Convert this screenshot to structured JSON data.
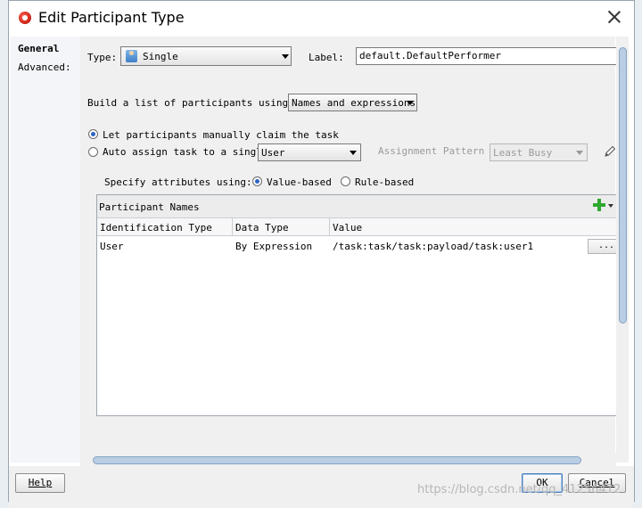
{
  "dialog": {
    "title": "Edit Participant Type"
  },
  "nav": {
    "items": [
      {
        "label": "General",
        "active": true
      },
      {
        "label": "Advanced:",
        "active": false
      }
    ]
  },
  "form": {
    "type_label": "Type:",
    "type_value": "Single",
    "label_label": "Label:",
    "label_value": "default.DefaultPerformer",
    "build_list_label": "Build a list of participants using:",
    "build_list_value": "Names and expressions",
    "radio_manual": "Let participants manually claim the task",
    "radio_auto": "Auto assign task to a single",
    "auto_target": "User",
    "assignment_pattern_label": "Assignment Pattern :",
    "assignment_pattern_value": "Least Busy",
    "specify_label": "Specify attributes using:",
    "value_based": "Value-based",
    "rule_based": "Rule-based"
  },
  "table": {
    "panel_title": "Participant Names",
    "columns": [
      "Identification Type",
      "Data Type",
      "Value"
    ],
    "rows": [
      {
        "identification_type": "User",
        "data_type": "By Expression",
        "value": "/task:task/task:payload/task:user1",
        "action": "..."
      }
    ]
  },
  "footer": {
    "help": "Help",
    "ok": "OK",
    "cancel": "Cancel"
  },
  "watermark": "https://blog.csdn.net/qq_41256412",
  "colors": {
    "accent": "#2b63c2",
    "add_icon": "#2ea82e",
    "scrollbar": "#b9cde3"
  }
}
